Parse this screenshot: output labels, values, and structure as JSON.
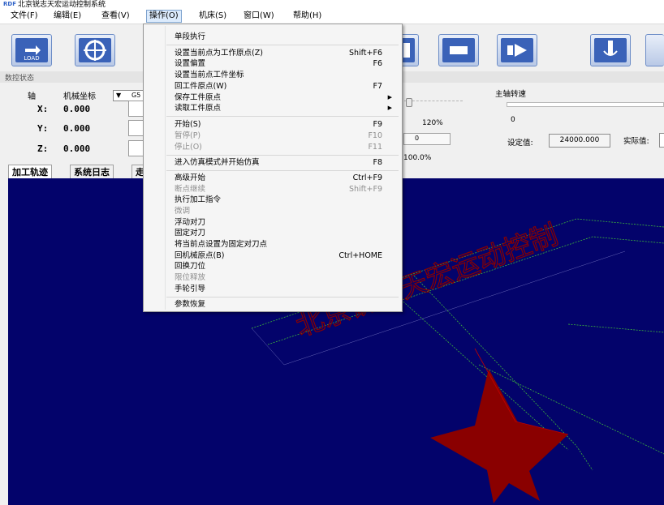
{
  "window": {
    "title": "北京锐志天宏运动控制系统",
    "icon_text": "RDF"
  },
  "menubar": [
    {
      "label": "文件(F)"
    },
    {
      "label": "编辑(E)"
    },
    {
      "label": "查看(V)"
    },
    {
      "label": "操作(O)"
    },
    {
      "label": "机床(S)"
    },
    {
      "label": "窗口(W)"
    },
    {
      "label": "帮助(H)"
    }
  ],
  "toolbar": {
    "load_label": "LOAD"
  },
  "nc_status": {
    "title": "数控状态",
    "axis_header": "轴",
    "coord_header": "机械坐标",
    "coord_select": "G5",
    "axes": [
      {
        "label": "X:",
        "value": "0.000"
      },
      {
        "label": "Y:",
        "value": "0.000"
      },
      {
        "label": "Z:",
        "value": "0.000"
      }
    ],
    "feed_percent": "120%",
    "feed_value": "0",
    "rapid_percent": "100.0%"
  },
  "spindle": {
    "title": "主轴转速",
    "value": "0",
    "set_label": "设定值:",
    "set_value": "24000.000",
    "actual_label": "实际值:"
  },
  "tabs": [
    {
      "label": "加工轨迹"
    },
    {
      "label": "系统日志"
    },
    {
      "label": "走"
    }
  ],
  "canvas_text": "北京锐志天宏运动控制",
  "colors": {
    "canvas_bg": "#03036b",
    "star": "#8a0000",
    "path": "#3cb43c"
  },
  "dropdown": {
    "items": [
      {
        "label": "单段执行",
        "shortcut": ""
      },
      {
        "label": "设置当前点为工作原点(Z)",
        "shortcut": "Shift+F6"
      },
      {
        "label": "设置偏置",
        "shortcut": "F6"
      },
      {
        "label": "设置当前点工件坐标",
        "shortcut": ""
      },
      {
        "label": "回工件原点(W)",
        "shortcut": "F7"
      },
      {
        "label": "保存工件原点",
        "shortcut": ""
      },
      {
        "label": "读取工件原点",
        "shortcut": ""
      },
      {
        "label": "开始(S)",
        "shortcut": "F9"
      },
      {
        "label": "暂停(P)",
        "shortcut": "F10"
      },
      {
        "label": "停止(O)",
        "shortcut": "F11"
      },
      {
        "label": "进入仿真模式并开始仿真",
        "shortcut": "F8"
      },
      {
        "label": "高级开始",
        "shortcut": "Ctrl+F9"
      },
      {
        "label": "断点继续",
        "shortcut": "Shift+F9"
      },
      {
        "label": "执行加工指令",
        "shortcut": ""
      },
      {
        "label": "微调",
        "shortcut": ""
      },
      {
        "label": "浮动对刀",
        "shortcut": ""
      },
      {
        "label": "固定对刀",
        "shortcut": ""
      },
      {
        "label": "将当前点设置为固定对刀点",
        "shortcut": ""
      },
      {
        "label": "回机械原点(B)",
        "shortcut": "Ctrl+HOME"
      },
      {
        "label": "回换刀位",
        "shortcut": ""
      },
      {
        "label": "限位释放",
        "shortcut": ""
      },
      {
        "label": "手轮引导",
        "shortcut": ""
      },
      {
        "label": "参数恢复",
        "shortcut": ""
      }
    ]
  }
}
